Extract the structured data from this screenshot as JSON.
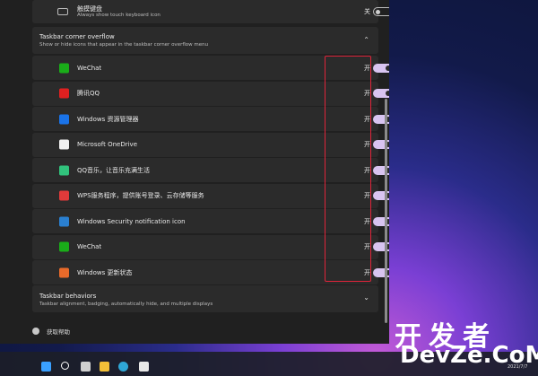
{
  "top_row": {
    "label": "触摸键盘",
    "sublabel": "Always show touch keyboard icon",
    "toggle_state": "关"
  },
  "overflow_section": {
    "title": "Taskbar corner overflow",
    "description": "Show or hide icons that appear in the taskbar corner overflow menu"
  },
  "apps": [
    {
      "label": "WeChat",
      "state": "开",
      "icon_color": "#1aad19",
      "icon": "wechat-icon"
    },
    {
      "label": "腾讯QQ",
      "state": "开",
      "icon_color": "#e02020",
      "icon": "qq-icon"
    },
    {
      "label": "Windows 资源管理器",
      "state": "开",
      "icon_color": "#1a73e8",
      "icon": "bluetooth-icon"
    },
    {
      "label": "Microsoft OneDrive",
      "state": "开",
      "icon_color": "#f0f0f0",
      "icon": "onedrive-icon"
    },
    {
      "label": "QQ音乐，让音乐充满生活",
      "state": "开",
      "icon_color": "#31c27c",
      "icon": "qq-music-icon"
    },
    {
      "label": "WPS服务程序，提供账号登录、云存储等服务",
      "state": "开",
      "icon_color": "#e03a3a",
      "icon": "wps-icon"
    },
    {
      "label": "Windows Security notification icon",
      "state": "开",
      "icon_color": "#2a7fd0",
      "icon": "security-icon"
    },
    {
      "label": "WeChat",
      "state": "开",
      "icon_color": "#1aad19",
      "icon": "wechat-icon"
    },
    {
      "label": "Windows 更新状态",
      "state": "开",
      "icon_color": "#e86a2a",
      "icon": "update-icon"
    }
  ],
  "behaviors_section": {
    "title": "Taskbar behaviors",
    "description": "Taskbar alignment, badging, automatically hide, and multiple displays"
  },
  "help": {
    "label": "获取帮助"
  },
  "watermark": {
    "line1": "开发者",
    "line2": "DevZe.CoM"
  },
  "clock": {
    "date": "2021/7/7"
  }
}
